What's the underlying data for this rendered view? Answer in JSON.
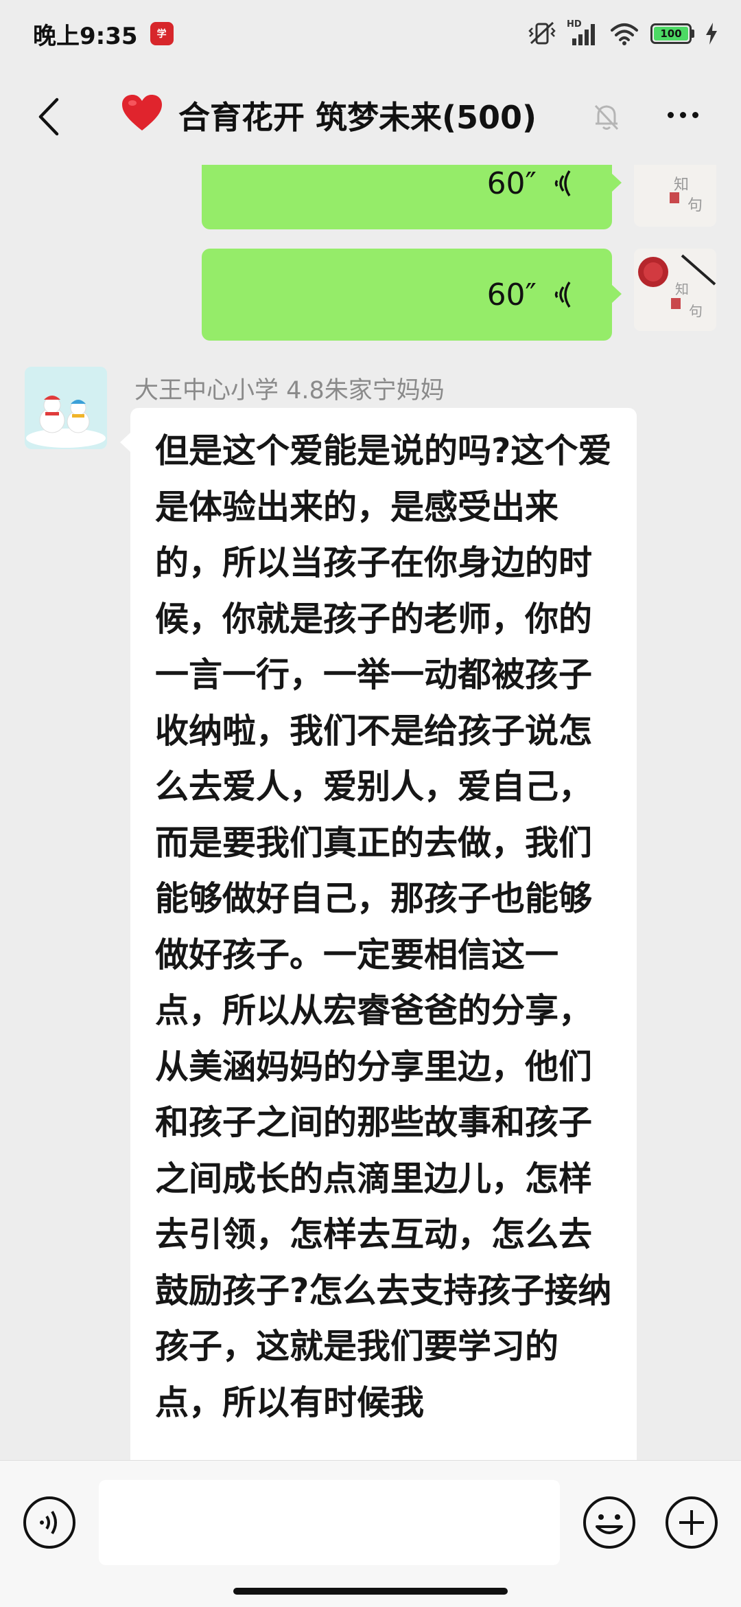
{
  "status_bar": {
    "time": "晚上9:35",
    "app_badge_icon": "news-app-icon",
    "network_label": "HD",
    "battery_level": "100",
    "battery_color": "#4cd964"
  },
  "header": {
    "back_icon": "chevron-left-icon",
    "title_emoji": "❤️",
    "title": "合育花开 筑梦未来(500)",
    "mute_icon": "bell-slash-icon",
    "more_icon": "more-dots-icon"
  },
  "messages": {
    "voice": [
      {
        "duration": "60″",
        "sender": "self"
      },
      {
        "duration": "60″",
        "sender": "self"
      }
    ],
    "text_message": {
      "sender_name": "大王中心小学 4.8朱家宁妈妈",
      "content": "但是这个爱能是说的吗?这个爱是体验出来的，是感受出来的，所以当孩子在你身边的时候，你就是孩子的老师，你的一言一行，一举一动都被孩子收纳啦，我们不是给孩子说怎么去爱人，爱别人，爱自己，而是要我们真正的去做，我们能够做好自己，那孩子也能够做好孩子。一定要相信这一点，所以从宏睿爸爸的分享，从美涵妈妈的分享里边，他们和孩子之间的那些故事和孩子之间成长的点滴里边儿，怎样去引领，怎样去互动，怎么去鼓励孩子?怎么去支持孩子接纳孩子，这就是我们要学习的点，所以有时候我"
    }
  },
  "input_bar": {
    "voice_icon": "voice-mode-icon",
    "placeholder": "",
    "emoji_icon": "emoji-smile-icon",
    "plus_icon": "plus-circle-icon"
  },
  "colors": {
    "self_bubble": "#95ec69",
    "other_bubble": "#ffffff",
    "background": "#ededed"
  }
}
